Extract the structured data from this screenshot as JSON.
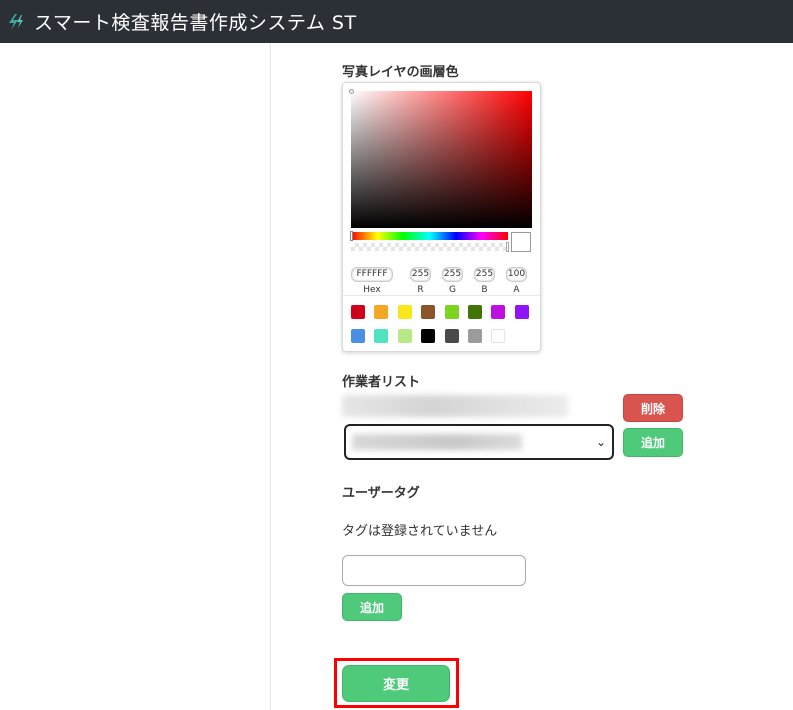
{
  "header": {
    "title": "スマート検査報告書作成システム ST",
    "logo_icon": "bolt-logo-icon",
    "bg_color": "#2b2f36"
  },
  "photo_layer": {
    "label": "写真レイヤの画層色",
    "picker": {
      "hex": "FFFFFF",
      "r": "255",
      "g": "255",
      "b": "255",
      "a": "100",
      "labels": {
        "hex": "Hex",
        "r": "R",
        "g": "G",
        "b": "B",
        "a": "A"
      },
      "preset_colors": [
        "#d0021b",
        "#f5a623",
        "#f8e71c",
        "#8b572a",
        "#7ed321",
        "#417505",
        "#bd10e0",
        "#9013fe",
        "#4a90e2",
        "#50e3c2",
        "#b8e986",
        "#000000",
        "#4a4a4a",
        "#9b9b9b",
        "#ffffff"
      ]
    }
  },
  "workers": {
    "label": "作業者リスト",
    "delete_label": "削除",
    "add_label": "追加"
  },
  "user_tags": {
    "label": "ユーザータグ",
    "empty_text": "タグは登録されていません",
    "input_placeholder": "",
    "add_label": "追加"
  },
  "submit": {
    "label": "変更"
  }
}
